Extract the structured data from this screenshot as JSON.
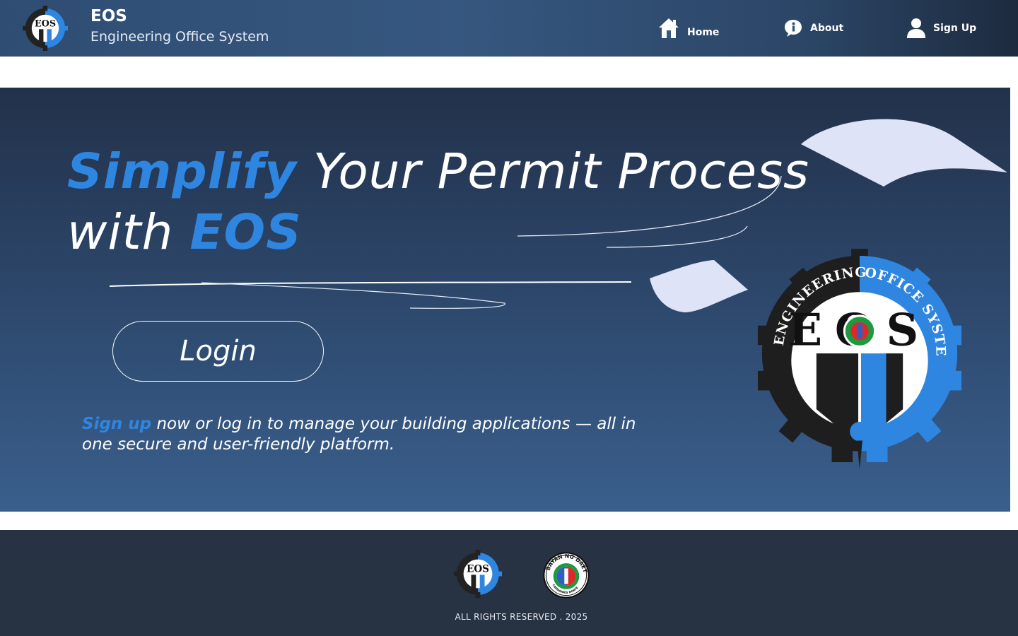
{
  "header": {
    "brand_title": "EOS",
    "brand_subtitle": "Engineering Office System",
    "logo_text": "EOS",
    "nav": [
      {
        "label": "Home",
        "icon": "home-icon"
      },
      {
        "label": "About",
        "icon": "info-icon"
      },
      {
        "label": "Sign Up",
        "icon": "user-icon"
      }
    ]
  },
  "hero": {
    "headline_accent_1": "Simplify",
    "headline_part_1": " Your Permit Process",
    "headline_part_2": "with ",
    "headline_accent_2": "EOS",
    "login_label": "Login",
    "tagline_link": "Sign up",
    "tagline_text": " now or log in to manage your building applications — all in one secure and user-friendly platform.",
    "logo": {
      "ring_text_left": "ENGINEERING",
      "ring_text_right": "OFFICE SYSTEM",
      "center_text": "EOS"
    }
  },
  "footer": {
    "seal_text": "BAYAN NG DAET",
    "seal_sub": "CAMARINES NORTE",
    "copyright": "ALL RIGHTS RESERVED . 2025"
  },
  "colors": {
    "accent": "#2f86e0",
    "header_bg": "#36577f",
    "footer_bg": "#273242",
    "gear_dark": "#222222",
    "gear_blue": "#2f86e0"
  }
}
